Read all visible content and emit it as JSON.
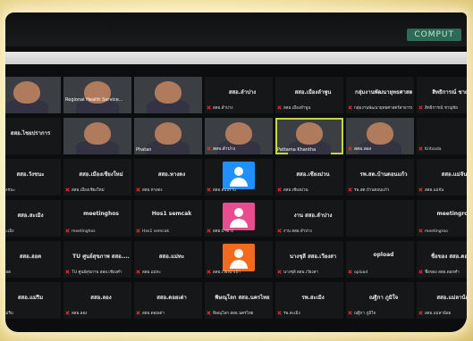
{
  "header": {
    "app_tag": "COMPUT"
  },
  "colors": {
    "muted": "#ff2d2d",
    "speaking_outline": "#c7d63b",
    "avatar_blue": "#1e90ff",
    "avatar_pink": "#e94d8f",
    "avatar_orange": "#f26b1d"
  },
  "tiles": [
    {
      "kind": "video",
      "label": "",
      "sub": "",
      "muted": false
    },
    {
      "kind": "video",
      "label": "Regional Health Service...",
      "sub": "",
      "muted": false
    },
    {
      "kind": "video",
      "label": "",
      "sub": "",
      "muted": false
    },
    {
      "kind": "name",
      "label": "สสอ.ลำปาง",
      "sub": "สสอ.ลำปาง",
      "muted": true
    },
    {
      "kind": "name",
      "label": "สสอ.เมืองลำพูน",
      "sub": "สสอ.เมืองลำพูน",
      "muted": true
    },
    {
      "kind": "name",
      "label": "กลุ่มงานพัฒนายุทธศาสตร์",
      "sub": "กลุ่มงานพัฒนายุทธศาสตร์สาธารณสุข",
      "muted": true
    },
    {
      "kind": "name",
      "label": "สิทธิการณ์ ชาญชัย",
      "sub": "สิทธิการณ์ ชาญชัย",
      "muted": true
    },
    {
      "kind": "name",
      "label": "สสอ.ไชยปราการ",
      "sub": "",
      "muted": false
    },
    {
      "kind": "video",
      "label": "",
      "sub": "",
      "muted": false
    },
    {
      "kind": "video",
      "label": "",
      "sub": "Phatan",
      "muted": false
    },
    {
      "kind": "video",
      "label": "",
      "sub": "สสจ.ลำปาง",
      "muted": true
    },
    {
      "kind": "video",
      "label": "",
      "sub": "Pattama Khantha",
      "muted": false,
      "speaking": true
    },
    {
      "kind": "video",
      "label": "",
      "sub": "สสอ.ลอง",
      "muted": true
    },
    {
      "kind": "name",
      "label": "",
      "sub": "Kritsada",
      "muted": true
    },
    {
      "kind": "name",
      "label": "สสอ.วังชนะ",
      "sub": "สสอ.วังชนะ",
      "muted": false
    },
    {
      "kind": "name",
      "label": "สสอ.เมืองเชียงใหม่",
      "sub": "สสอ.เมืองเชียงใหม่",
      "muted": true
    },
    {
      "kind": "name",
      "label": "สสอ.หางดง",
      "sub": "สสอ.หางดง",
      "muted": true
    },
    {
      "kind": "avatar",
      "label": "",
      "sub": "สสอ.สบปราบ",
      "muted": true,
      "color": "avatar_blue"
    },
    {
      "kind": "name",
      "label": "สสอ.เชียงม่วน",
      "sub": "สสอ.เชียงม่วน",
      "muted": true
    },
    {
      "kind": "name",
      "label": "รพ.สต.บ้านดอนแก้ว",
      "sub": "รพ.สต.บ้านดอนแก้ว",
      "muted": true
    },
    {
      "kind": "name",
      "label": "สสอ.แม่จัน",
      "sub": "สสอ.แม่จัน",
      "muted": true
    },
    {
      "kind": "name",
      "label": "สสอ.สะเมิง",
      "sub": "สสอ.สะเมิง",
      "muted": false
    },
    {
      "kind": "name",
      "label": "meetinghos",
      "sub": "meetinghos",
      "muted": true
    },
    {
      "kind": "name",
      "label": "Hos1 semcak",
      "sub": "Hos1 semcak",
      "muted": true
    },
    {
      "kind": "avatar",
      "label": "",
      "sub": "สสอ.ป่าซาง",
      "muted": true,
      "color": "avatar_pink"
    },
    {
      "kind": "name",
      "label": "งาน สสอ.ลำปาง",
      "sub": "งาน สสอ.ลำปาง",
      "muted": true
    },
    {
      "kind": "name",
      "label": "",
      "sub": "",
      "muted": false
    },
    {
      "kind": "name",
      "label": "meetingroo",
      "sub": "meetingroo",
      "muted": true
    },
    {
      "kind": "name",
      "label": "สสอ.ฮอด",
      "sub": "สสอ.ฮอด",
      "muted": false
    },
    {
      "kind": "name",
      "label": "TU ศูนย์สุขภาพ สสอ....",
      "sub": "TU ศูนย์สุขภาพ สสอ.เชียงคำ",
      "muted": true
    },
    {
      "kind": "name",
      "label": "สสอ.แม่ทะ",
      "sub": "สสอ.แม่ทะ",
      "muted": true
    },
    {
      "kind": "avatar",
      "label": "",
      "sub": "สสอ.เวียงป่าเป้า",
      "muted": true,
      "color": "avatar_orange"
    },
    {
      "kind": "name",
      "label": "นางชุลี สสอ.เวียงสา",
      "sub": "นางชุลี สสอ.เวียงสา",
      "muted": true
    },
    {
      "kind": "name",
      "label": "opload",
      "sub": "opload",
      "muted": true
    },
    {
      "kind": "name",
      "label": "ชื่อของ สสอ.ดอกคำ",
      "sub": "ชื่อของ สสอ.ดอกคำ",
      "muted": true
    },
    {
      "kind": "name",
      "label": "สสอ.แม่ริม",
      "sub": "สสอ.แม่ริม",
      "muted": false
    },
    {
      "kind": "name",
      "label": "สสอ.ลอง",
      "sub": "สสอ.ลอง",
      "muted": true
    },
    {
      "kind": "name",
      "label": "สสอ.ดอยเต่า",
      "sub": "สสอ.ดอยเต่า",
      "muted": true
    },
    {
      "kind": "name",
      "label": "พิษณุโลก สสอ.นครไทย",
      "sub": "พิษณุโลก สสอ.นครไทย",
      "muted": true
    },
    {
      "kind": "name",
      "label": "รพ.สะเมิง",
      "sub": "รพ.สะเมิง",
      "muted": true
    },
    {
      "kind": "name",
      "label": "ณฐิกา ภูมิใจ",
      "sub": "ณฐิกา ภูมิใจ",
      "muted": true
    },
    {
      "kind": "name",
      "label": "สสอ.แม่ลาน้อย",
      "sub": "สสอ.แม่ลาน้อย",
      "muted": true
    }
  ]
}
